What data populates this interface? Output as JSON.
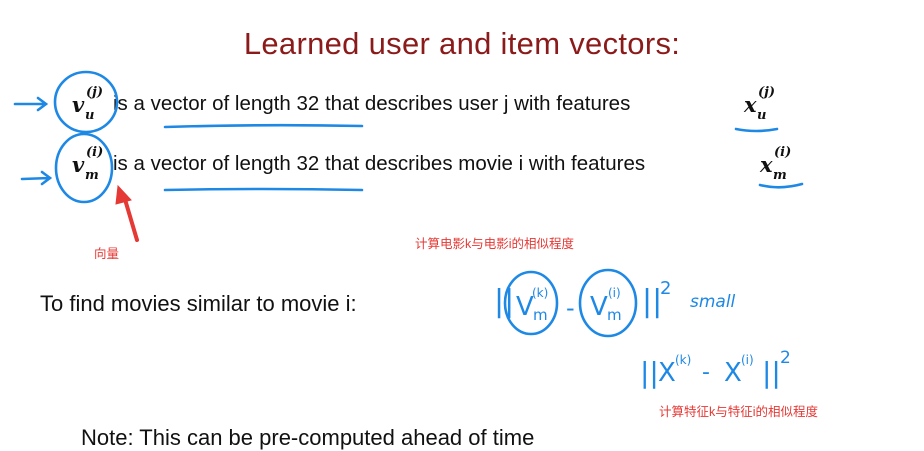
{
  "title": "Learned user and item vectors:",
  "lines": [
    {
      "vec_base": "v",
      "vec_sub": "u",
      "vec_sup": "(j)",
      "text": "is a vector of length 32 that describes user j with features",
      "feat_base": "x",
      "feat_sub": "u",
      "feat_sup": "(j)"
    },
    {
      "vec_base": "v",
      "vec_sub": "m",
      "vec_sup": "(i)",
      "text": "is a vector of length 32 that describes movie i with features",
      "feat_base": "x",
      "feat_sub": "m",
      "feat_sup": "(i)"
    }
  ],
  "annotations": {
    "vector_label": "向量",
    "movie_similarity": "计算电影k与电影i的相似程度",
    "feature_similarity": "计算特征k与特征i的相似程度"
  },
  "find_similar": "To find movies similar to movie i:",
  "handwritten": {
    "v_base": "V",
    "v_sub": "m",
    "k_sup": "(k)",
    "i_sup": "(i)",
    "minus": "-",
    "squared": "2",
    "small": "small",
    "x_base": "X",
    "norm_bars": "||"
  },
  "note": "Note: This can be pre-computed ahead of time",
  "colors": {
    "title": "#8b1a1a",
    "ink_blue": "#1e88e5",
    "annotation_red": "#e53935"
  }
}
